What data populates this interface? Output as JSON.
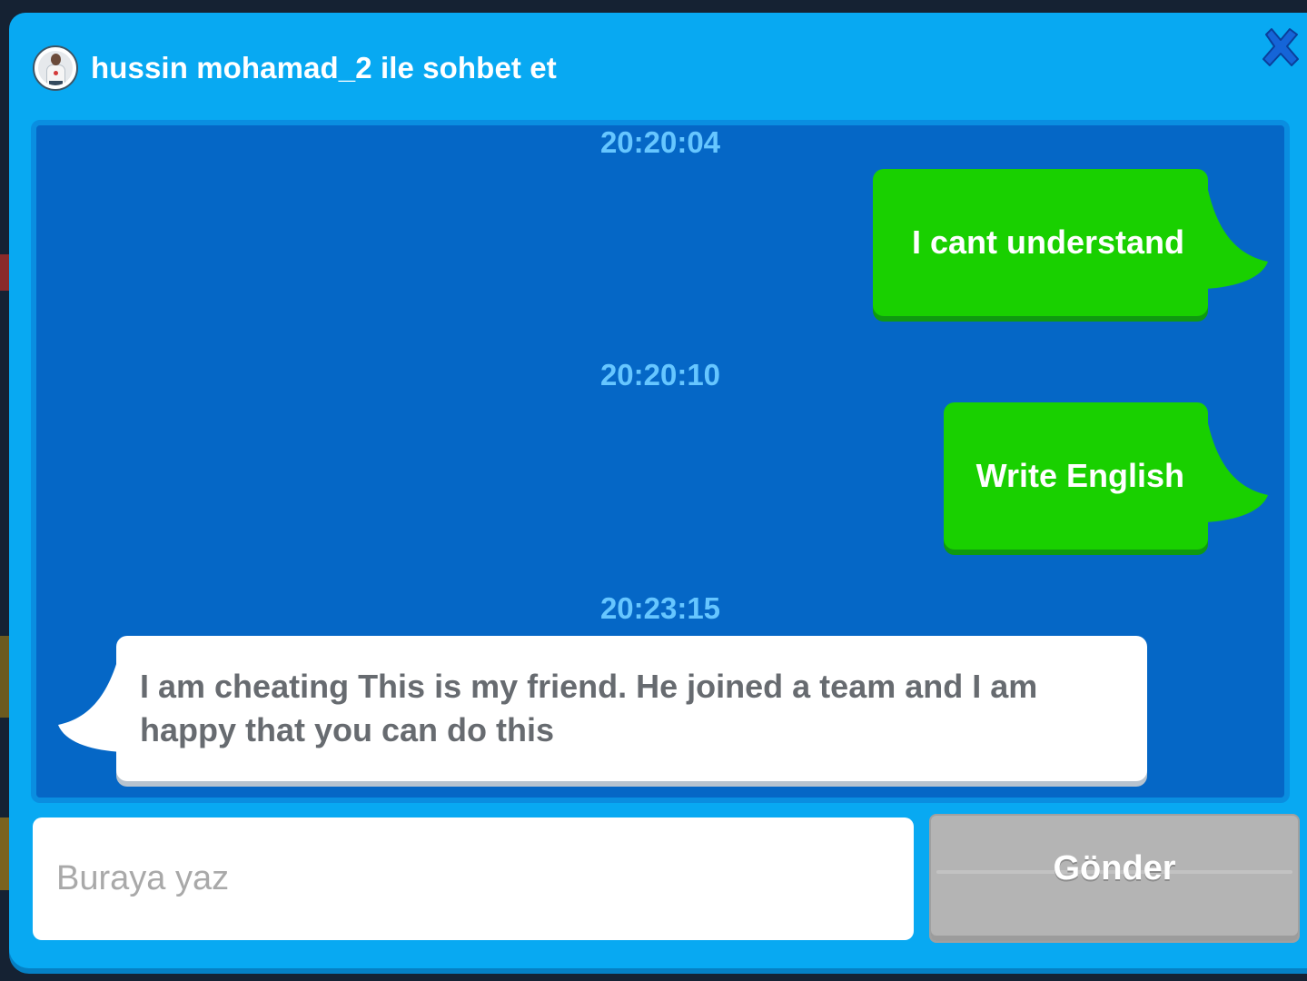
{
  "header": {
    "title": "hussin mohamad_2 ile sohbet et",
    "avatar_icon": "user-avatar",
    "close_icon": "close-x-icon"
  },
  "messages": [
    {
      "time": "20:20:04",
      "text": "I cant understand",
      "sender": "self"
    },
    {
      "time": "20:20:10",
      "text": "Write English",
      "sender": "self"
    },
    {
      "time": "20:23:15",
      "text": "I am cheating This is my friend. He joined a team and I am happy that you can do this",
      "sender": "other"
    }
  ],
  "composer": {
    "placeholder": "Buraya yaz",
    "value": "",
    "send_label": "Gönder"
  },
  "colors": {
    "dialog": "#08a9f2",
    "chat_bg": "#0567c6",
    "timestamp": "#66c6ff",
    "self_bubble": "#19d000",
    "other_bubble": "#ffffff",
    "send_disabled": "#b4b4b4",
    "close_icon": "#1565d8"
  }
}
